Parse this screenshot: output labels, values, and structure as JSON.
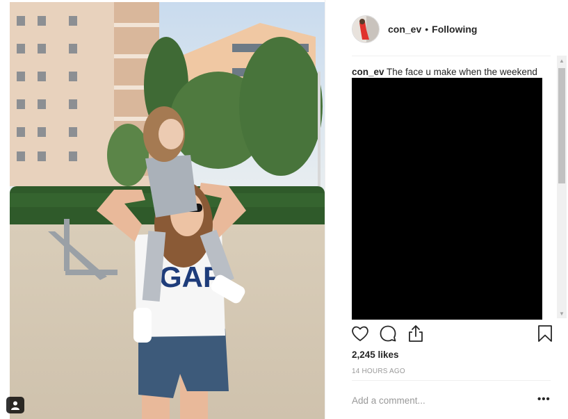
{
  "post": {
    "username": "con_ev",
    "separator": "•",
    "follow_state": "Following",
    "caption_user": "con_ev",
    "caption_text": "The face u make when the weekend is just a day away",
    "likes": "2,245 likes",
    "timestamp": "14 HOURS AGO",
    "comment_placeholder": "Add a comment...",
    "more_label": "•••"
  },
  "icons": {
    "like": "heart-icon",
    "comment": "comment-icon",
    "share": "share-icon",
    "save": "bookmark-icon",
    "tag": "user-tag-icon"
  },
  "colors": {
    "text": "#262626",
    "muted": "#999999",
    "divider": "#efefef"
  }
}
